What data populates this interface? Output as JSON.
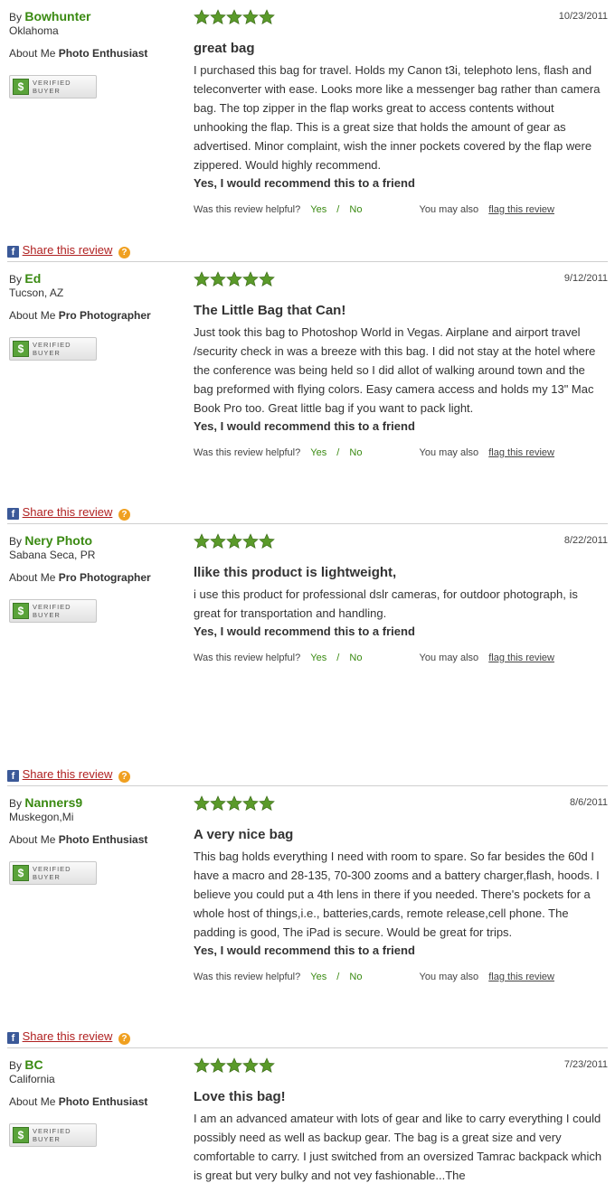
{
  "labels": {
    "by": "By",
    "about_me": "About Me",
    "verified_line1": "VERIFIED",
    "verified_line2": "BUYER",
    "dollar": "$",
    "helpful_q": "Was this review helpful?",
    "yes": "Yes",
    "no": "No",
    "slash": "/",
    "may_also": "You may also",
    "flag": "flag this review",
    "share": "Share this review",
    "fb": "f",
    "q": "?"
  },
  "colors": {
    "star_green": "#5a9a2a",
    "name_green": "#3a8a12",
    "share_red": "#b02020"
  },
  "reviews": [
    {
      "name": "Bowhunter",
      "location": "Oklahoma",
      "about": "Photo Enthusiast",
      "rating": 5,
      "date": "10/23/2011",
      "title": "great bag",
      "body": "I purchased this bag for travel. Holds my Canon t3i, telephoto lens, flash and teleconverter with ease. Looks more like a messenger bag rather than camera bag. The top zipper in the flap works great to access contents without unhooking the flap. This is a great size that holds the amount of gear as advertised. Minor complaint, wish the inner pockets covered by the flap were zippered. Would highly recommend.",
      "recommend": "Yes, I would recommend this to a friend"
    },
    {
      "name": "Ed",
      "location": "Tucson, AZ",
      "about": "Pro Photographer",
      "rating": 5,
      "date": "9/12/2011",
      "title": "The Little Bag that Can!",
      "body": "Just took this bag to Photoshop World in Vegas. Airplane and airport travel /security check in was a breeze with this bag. I did not stay at the hotel where the conference was being held so I did allot of walking around town and the bag preformed with flying colors. Easy camera access and holds my 13\" Mac Book Pro too. Great little bag if you want to pack light.",
      "recommend": "Yes, I would recommend this to a friend"
    },
    {
      "name": "Nery Photo",
      "location": "Sabana Seca, PR",
      "about": "Pro Photographer",
      "rating": 5,
      "date": "8/22/2011",
      "title": "llike this product is lightweight,",
      "body": "i use this product for professional dslr cameras, for outdoor photograph, is great for transportation and handling.",
      "recommend": "Yes, I would recommend this to a friend"
    },
    {
      "name": "Nanners9",
      "location": "Muskegon,Mi",
      "about": "Photo Enthusiast",
      "rating": 5,
      "date": "8/6/2011",
      "title": "A very nice bag",
      "body": "This bag holds everything I need with room to spare. So far besides the 60d I have a macro and 28-135, 70-300 zooms and a battery charger,flash, hoods. I believe you could put a 4th lens in there if you needed. There's pockets for a whole host of things,i.e., batteries,cards, remote release,cell phone. The padding is good, The iPad is secure. Would be great for trips.",
      "recommend": "Yes, I would recommend this to a friend"
    },
    {
      "name": "BC",
      "location": "California",
      "about": "Photo Enthusiast",
      "rating": 5,
      "date": "7/23/2011",
      "title": "Love this bag!",
      "body": "I am an advanced amateur with lots of gear and like to carry everything I could possibly need as well as backup gear. The bag is a great size and very comfortable to carry. I just switched from an oversized Tamrac backpack which is great but very bulky and not vey fashionable...The"
    }
  ]
}
